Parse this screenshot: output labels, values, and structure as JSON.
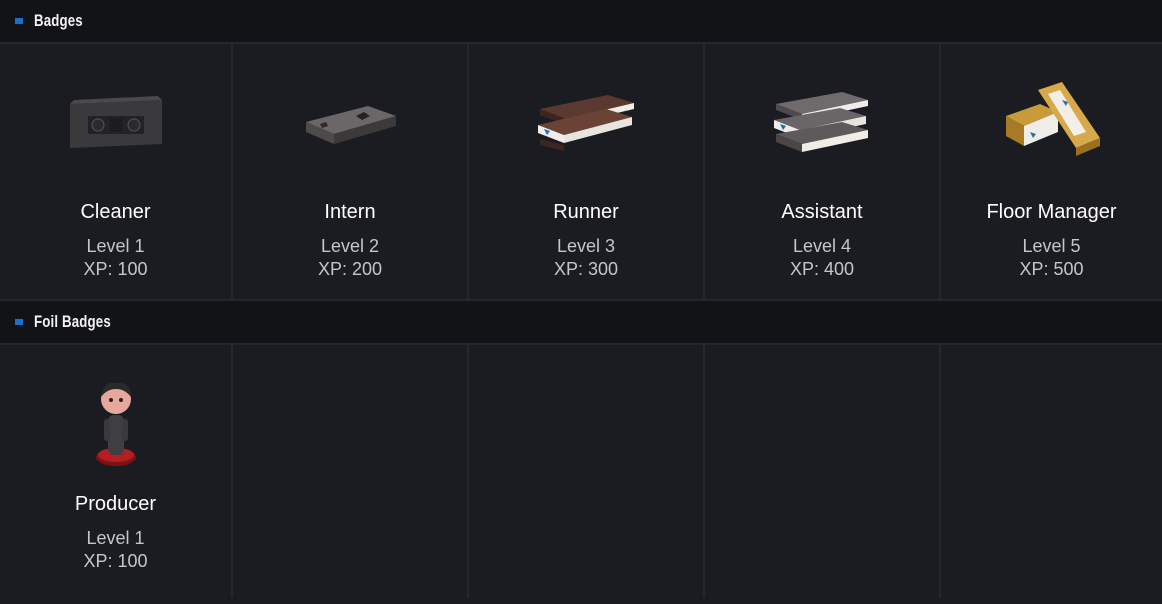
{
  "sections": {
    "badges": {
      "title": "Badges",
      "items": [
        {
          "name": "Cleaner",
          "level": "Level 1",
          "xp": "XP: 100",
          "icon": "vhs-tape-icon"
        },
        {
          "name": "Intern",
          "level": "Level 2",
          "xp": "XP: 200",
          "icon": "vhs-tape-icon"
        },
        {
          "name": "Runner",
          "level": "Level 3",
          "xp": "XP: 300",
          "icon": "vhs-tape-stack-icon"
        },
        {
          "name": "Assistant",
          "level": "Level 4",
          "xp": "XP: 400",
          "icon": "vhs-tape-stack-icon"
        },
        {
          "name": "Floor Manager",
          "level": "Level 5",
          "xp": "XP: 500",
          "icon": "gold-vhs-tape-stack-icon"
        }
      ]
    },
    "foil_badges": {
      "title": "Foil Badges",
      "items": [
        {
          "name": "Producer",
          "level": "Level 1",
          "xp": "XP: 100",
          "icon": "bobblehead-icon"
        }
      ]
    }
  },
  "colors": {
    "accent": "#1b6fd1",
    "header_bg": "#121316",
    "cell_bg": "#1b1c21",
    "border": "#26272c"
  }
}
